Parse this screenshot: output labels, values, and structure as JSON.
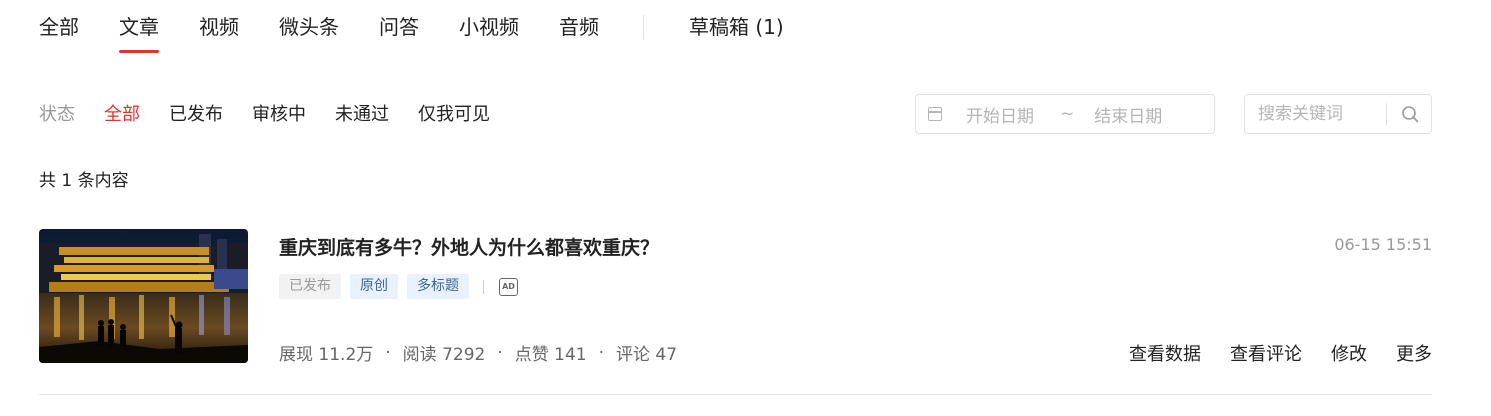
{
  "tabs": [
    {
      "label": "全部",
      "active": false
    },
    {
      "label": "文章",
      "active": true
    },
    {
      "label": "视频",
      "active": false
    },
    {
      "label": "微头条",
      "active": false
    },
    {
      "label": "问答",
      "active": false
    },
    {
      "label": "小视频",
      "active": false
    },
    {
      "label": "音频",
      "active": false
    }
  ],
  "draft_tab": "草稿箱 (1)",
  "status_filter": {
    "label": "状态",
    "options": [
      "全部",
      "已发布",
      "审核中",
      "未通过",
      "仅我可见"
    ],
    "selected": "全部"
  },
  "date_range": {
    "start_placeholder": "开始日期",
    "separator": "~",
    "end_placeholder": "结束日期"
  },
  "search": {
    "placeholder": "搜索关键词",
    "value": ""
  },
  "count_text": "共 1 条内容",
  "article": {
    "title": "重庆到底有多牛？外地人为什么都喜欢重庆？",
    "time": "06-15 15:51",
    "tags": [
      {
        "label": "已发布",
        "style": "gray"
      },
      {
        "label": "原创",
        "style": "blue"
      },
      {
        "label": "多标题",
        "style": "blue"
      }
    ],
    "ad_badge": "AD",
    "stats": [
      {
        "label": "展现 11.2万"
      },
      {
        "label": "阅读 7292"
      },
      {
        "label": "点赞 141"
      },
      {
        "label": "评论 47"
      }
    ],
    "stat_separator": "·",
    "actions": [
      "查看数据",
      "查看评论",
      "修改",
      "更多"
    ]
  },
  "colors": {
    "accent": "#e1342b",
    "tag_blue_bg": "#e8f1fd",
    "tag_blue_text": "#406599",
    "muted": "#999999"
  }
}
